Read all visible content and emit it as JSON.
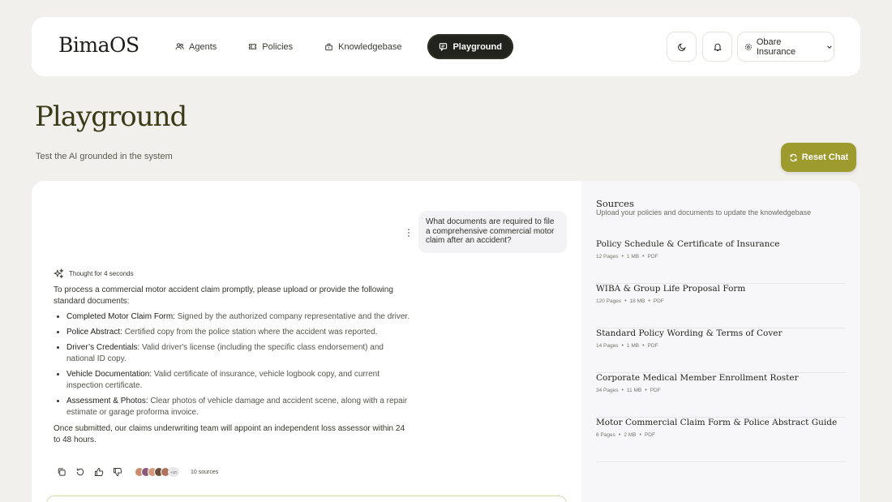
{
  "app": {
    "logo": "BimaOS"
  },
  "nav": {
    "items": [
      {
        "label": "Agents",
        "icon": "users-icon"
      },
      {
        "label": "Policies",
        "icon": "ticket-icon"
      },
      {
        "label": "Knowledgebase",
        "icon": "box-icon"
      },
      {
        "label": "Playground",
        "icon": "chat-icon",
        "active": true
      }
    ],
    "theme_icon": "moon-icon",
    "notifications_icon": "bell-icon",
    "org": {
      "label": "Obare Insurance",
      "icon": "gear-icon"
    }
  },
  "page": {
    "title": "Playground",
    "subtitle": "Test the AI grounded in the system",
    "reset_label": "Reset Chat"
  },
  "chat": {
    "user_message": "What documents are required to file a comprehensive commercial motor claim after an accident?",
    "thought_label": "Thought for 4 seconds",
    "answer_intro": "To process a commercial motor accident claim promptly, please upload or provide the following standard documents:",
    "answer_items": [
      {
        "title": "Completed Motor Claim Form:",
        "desc": "Signed by the authorized company representative and the driver."
      },
      {
        "title": "Police Abstract:",
        "desc": "Certified copy from the police station where the accident was reported."
      },
      {
        "title": "Driver’s Credentials:",
        "desc": "Valid driver's license (including the specific class endorsement) and national ID copy."
      },
      {
        "title": "Vehicle Documentation:",
        "desc": "Valid certificate of insurance, vehicle logbook copy, and current inspection certificate."
      },
      {
        "title": "Assessment & Photos:",
        "desc": "Clear photos of vehicle damage and accident scene, along with a repair estimate or garage proforma invoice."
      }
    ],
    "answer_outro": "Once submitted, our claims underwriting team will appoint an independent loss assessor within 24 to 48 hours.",
    "avatars_more": "+10",
    "sources_count": "10 sources"
  },
  "sources": {
    "title": "Sources",
    "subtitle": "Upload your policies and documents to update the knowledgebase",
    "items": [
      {
        "name": "Policy Schedule & Certificate of Insurance",
        "pages": "12 Pages",
        "size": "1 MB",
        "type": "PDF"
      },
      {
        "name": "WIBA & Group Life Proposal Form",
        "pages": "120 Pages",
        "size": "18 MB",
        "type": "PDF"
      },
      {
        "name": "Standard Policy Wording & Terms of Cover",
        "pages": "14 Pages",
        "size": "1 MB",
        "type": "PDF"
      },
      {
        "name": "Corporate Medical Member Enrollment Roster",
        "pages": "34 Pages",
        "size": "11 MB",
        "type": "PDF"
      },
      {
        "name": "Motor Commercial Claim Form & Police Abstract Guide",
        "pages": "6 Pages",
        "size": "2 MB",
        "type": "PDF"
      }
    ],
    "separator": "•"
  },
  "colors": {
    "accent": "#9d9b2e",
    "title": "#3b3a18",
    "nav_active": "#23231d",
    "background": "#f1f0ec"
  }
}
